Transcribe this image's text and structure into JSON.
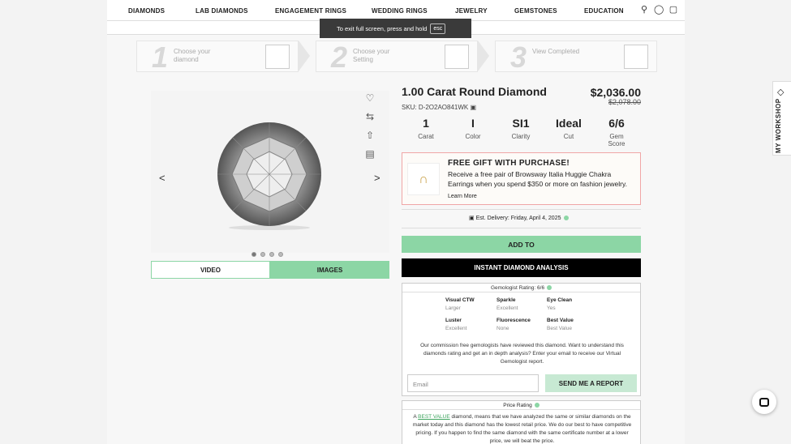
{
  "nav": {
    "items": [
      "DIAMONDS",
      "LAB DIAMONDS",
      "ENGAGEMENT RINGS",
      "WEDDING RINGS",
      "JEWELRY",
      "GEMSTONES",
      "EDUCATION"
    ],
    "icons": [
      "search-icon",
      "user-icon",
      "cart-icon"
    ]
  },
  "toast": {
    "text": "To exit full screen, press and hold",
    "key": "esc"
  },
  "steps": [
    {
      "num": "1",
      "label": "Choose your diamond"
    },
    {
      "num": "2",
      "label": "Choose your Setting"
    },
    {
      "num": "3",
      "label": "View Completed"
    }
  ],
  "gallery": {
    "prev": "<",
    "next": ">",
    "tabs": {
      "video": "VIDEO",
      "images": "IMAGES"
    }
  },
  "product": {
    "title": "1.00 Carat Round Diamond",
    "price": "$2,036.00",
    "old_price": "$2,078.00",
    "sku": "SKU: D-2O2AO841WK",
    "specs": [
      {
        "value": "1",
        "label": "Carat"
      },
      {
        "value": "I",
        "label": "Color"
      },
      {
        "value": "SI1",
        "label": "Clarity"
      },
      {
        "value": "Ideal",
        "label": "Cut"
      },
      {
        "value": "6/6",
        "label": "Gem Score"
      }
    ]
  },
  "promo": {
    "heading": "FREE GIFT WITH PURCHASE!",
    "text": "Receive a free pair of Browsway Italia Huggie Chakra Earrings when you spend $350 or more on fashion jewelry.",
    "learn_more": "Learn More"
  },
  "delivery": "Est. Delivery: Friday, April 4, 2025",
  "buttons": {
    "add": "ADD TO",
    "instant": "INSTANT DIAMOND ANALYSIS",
    "send": "SEND ME A REPORT"
  },
  "gemologist": {
    "header": "Gemologist Rating: 6/6",
    "features": [
      {
        "name": "Visual CTW",
        "value": "Larger"
      },
      {
        "name": "Sparkle",
        "value": "Excellent"
      },
      {
        "name": "Eye Clean",
        "value": "Yes"
      },
      {
        "name": "Luster",
        "value": "Excellent"
      },
      {
        "name": "Fluorescence",
        "value": "None"
      },
      {
        "name": "Best Value",
        "value": "Best Value"
      }
    ],
    "paragraph": "Our commission free gemologists have reviewed this diamond. Want to understand this diamonds rating and get an in depth analysis? Enter your email to receive our Virtual Gemologist report.",
    "email_placeholder": "Email"
  },
  "price_rating": {
    "header": "Price Rating",
    "lead": "A",
    "best_value": "BEST VALUE",
    "text": "diamond, means that we have analyzed the same or similar diamonds on the market today and this diamond has the lowest retail price. We do our best to have competitive pricing. If you happen to find the same diamond with the same certificate number at a lower price, we will beat the price."
  },
  "workshop": "MY WORKSHOP"
}
